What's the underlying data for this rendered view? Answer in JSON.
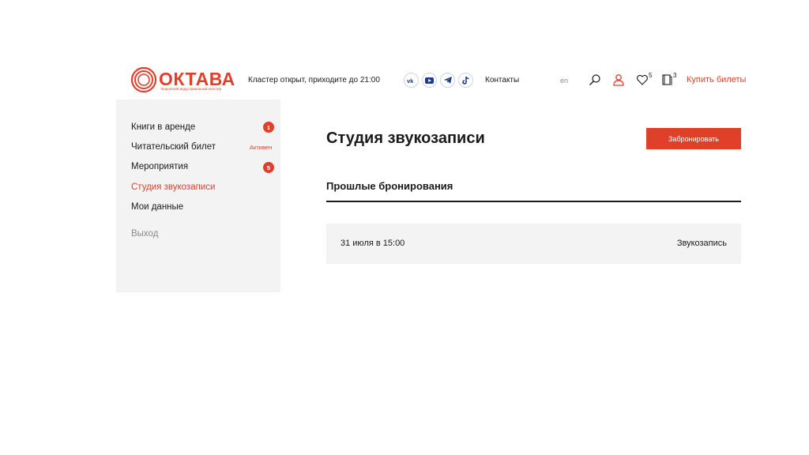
{
  "header": {
    "logo_text": "ОКТАВА",
    "logo_tagline": "творческий индустриальный кластер",
    "open_status": "Кластер открыт, приходите до 21:00",
    "socials": [
      "vk-icon",
      "youtube-icon",
      "telegram-icon",
      "tiktok-icon"
    ],
    "contacts_label": "Контакты",
    "lang_label": "en",
    "favorites_count": "5",
    "books_count": "3",
    "buy_tickets_label": "Купить билеты",
    "accent_color": "#e0402a"
  },
  "sidebar": {
    "items": [
      {
        "label": "Книги в аренде",
        "badge": "1"
      },
      {
        "label": "Читательский билет",
        "status": "Активен"
      },
      {
        "label": "Мероприятия",
        "badge": "5"
      },
      {
        "label": "Студия звукозаписи",
        "active": true
      },
      {
        "label": "Мои данные"
      }
    ],
    "logout_label": "Выход"
  },
  "main": {
    "title": "Студия звукозаписи",
    "book_button_label": "Забронировать",
    "section_title": "Прошлые бронирования",
    "bookings": [
      {
        "date": "31 июля в 15:00",
        "type": "Звукозапись"
      }
    ]
  }
}
